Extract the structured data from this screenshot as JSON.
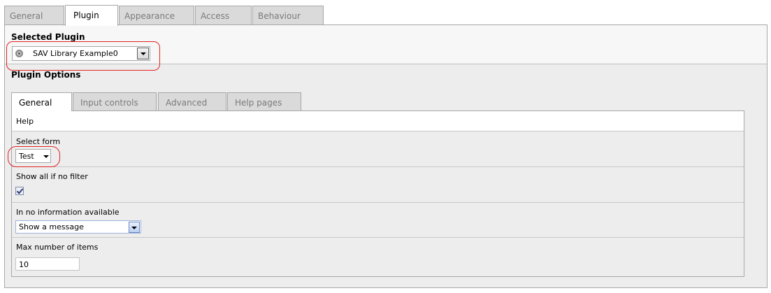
{
  "top_tabs": [
    "General",
    "Plugin",
    "Appearance",
    "Access",
    "Behaviour"
  ],
  "top_active_tab": "Plugin",
  "selected_plugin": {
    "heading": "Selected Plugin",
    "value": "SAV Library Example0"
  },
  "plugin_options_heading": "Plugin Options",
  "inner_tabs": [
    "General",
    "Input controls",
    "Advanced",
    "Help pages"
  ],
  "inner_active_tab": "General",
  "form": {
    "help_label": "Help",
    "select_form": {
      "label": "Select form",
      "value": "Test"
    },
    "show_all": {
      "label": "Show all if no filter",
      "checked": true
    },
    "no_info": {
      "label": "In no information available",
      "value": "Show a message"
    },
    "max_items": {
      "label": "Max number of items",
      "value": "10"
    }
  },
  "colors": {
    "highlight_ring": "#e02424",
    "panel_bg": "#ededed",
    "tab_inactive_bg": "#dadada",
    "border": "#a7a7a7"
  }
}
